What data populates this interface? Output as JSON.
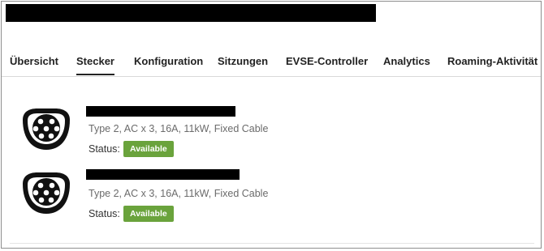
{
  "tabs": [
    {
      "label": "Übersicht",
      "active": false
    },
    {
      "label": "Stecker",
      "active": true
    },
    {
      "label": "Konfiguration",
      "active": false
    },
    {
      "label": "Sitzungen",
      "active": false
    },
    {
      "label": "EVSE-Controller",
      "active": false
    },
    {
      "label": "Analytics",
      "active": false
    },
    {
      "label": "Roaming-Aktivität",
      "active": false
    }
  ],
  "connectors": [
    {
      "icon": "type2-plug-icon",
      "spec": "Type 2, AC x 3, 16A, 11kW, Fixed Cable",
      "status_label": "Status:",
      "status": "Available"
    },
    {
      "icon": "type2-plug-icon",
      "spec": "Type 2, AC x 3, 16A, 11kW, Fixed Cable",
      "status_label": "Status:",
      "status": "Available"
    }
  ],
  "colors": {
    "status_available": "#6aa33c",
    "redaction": "#000000"
  }
}
